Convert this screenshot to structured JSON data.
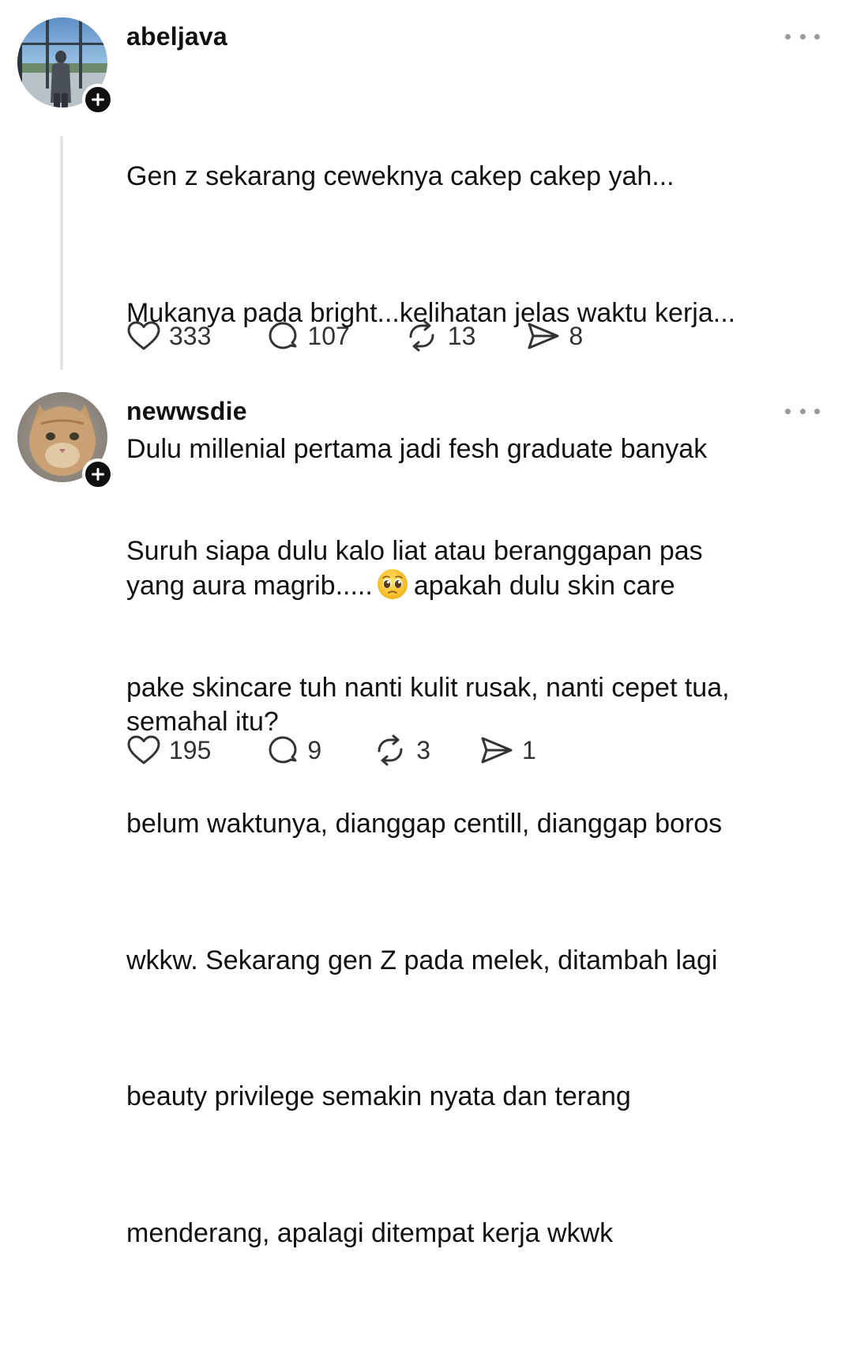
{
  "posts": [
    {
      "username": "abeljava",
      "lines": [
        "Gen z sekarang ceweknya cakep cakep yah...",
        "Mukanya pada bright...kelihatan jelas waktu kerja...",
        "Dulu millenial pertama jadi fesh graduate banyak",
        "yang aura magrib.....",
        "apakah dulu skin care",
        "semahal itu?"
      ],
      "likes": "333",
      "replies": "107",
      "reposts": "13",
      "shares": "8"
    },
    {
      "username": "newwsdie",
      "lines": [
        "Suruh siapa dulu kalo liat atau beranggapan pas",
        "pake skincare tuh nanti kulit rusak, nanti cepet tua,",
        "belum waktunya, dianggap centill, dianggap boros",
        "wkkw. Sekarang gen Z pada melek, ditambah lagi",
        "beauty privilege semakin nyata dan terang",
        "menderang, apalagi ditempat kerja wkwk"
      ],
      "likes": "195",
      "replies": "9",
      "reposts": "3",
      "shares": "1"
    }
  ],
  "icons": {
    "like": "heart-icon",
    "reply": "speech-bubble-icon",
    "repost": "repost-arrows-icon",
    "share": "send-icon",
    "more": "ellipsis-icon",
    "follow": "plus-icon",
    "emoji": "pleading-face-emoji"
  },
  "colors": {
    "text": "#111111",
    "icon": "#333333",
    "muted": "#9a9a9a",
    "thread_line": "#e3e3e3",
    "badge": "#101010"
  }
}
